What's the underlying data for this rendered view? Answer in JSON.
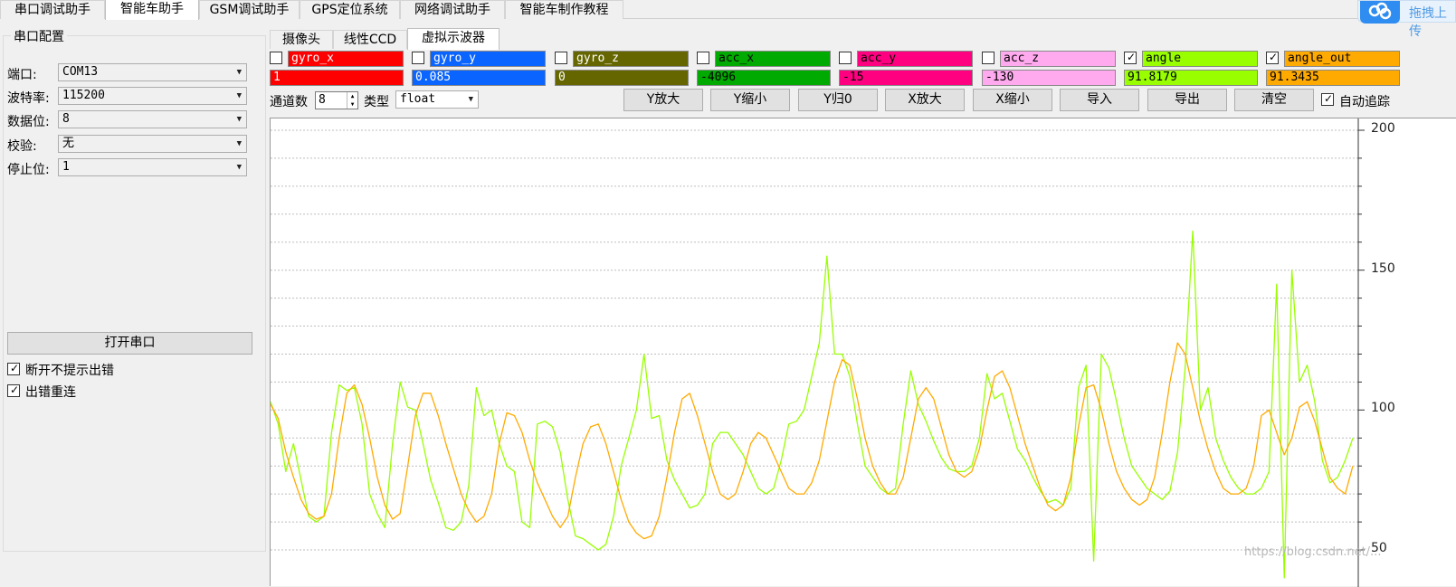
{
  "top_tabs": [
    {
      "label": "串口调试助手"
    },
    {
      "label": "智能车助手"
    },
    {
      "label": "GSM调试助手"
    },
    {
      "label": "GPS定位系统"
    },
    {
      "label": "网络调试助手"
    },
    {
      "label": "智能车制作教程"
    }
  ],
  "upload": {
    "label": "拖拽上传"
  },
  "serial_config": {
    "title": "串口配置",
    "fields": [
      {
        "label": "端口:",
        "value": "COM13"
      },
      {
        "label": "波特率:",
        "value": "115200"
      },
      {
        "label": "数据位:",
        "value": "8"
      },
      {
        "label": "校验:",
        "value": "无"
      },
      {
        "label": "停止位:",
        "value": "1"
      }
    ],
    "open_button": "打开串口",
    "options": [
      {
        "label": "断开不提示出错",
        "checked": true
      },
      {
        "label": "出错重连",
        "checked": true
      }
    ]
  },
  "inner_tabs": [
    {
      "label": "摄像头"
    },
    {
      "label": "线性CCD"
    },
    {
      "label": "虚拟示波器"
    }
  ],
  "channels": [
    {
      "name": "gyro_x",
      "value": "1",
      "checked": false,
      "color": "#ff0000",
      "text_color": "#ffffff"
    },
    {
      "name": "gyro_y",
      "value": "0.085",
      "checked": false,
      "color": "#0a64ff",
      "text_color": "#ffffff"
    },
    {
      "name": "gyro_z",
      "value": "0",
      "checked": false,
      "color": "#666600",
      "text_color": "#ffffff"
    },
    {
      "name": "acc_x",
      "value": "-4096",
      "checked": false,
      "color": "#00aa00",
      "text_color": "#000000"
    },
    {
      "name": "acc_y",
      "value": "-15",
      "checked": false,
      "color": "#ff0080",
      "text_color": "#000000"
    },
    {
      "name": "acc_z",
      "value": "-130",
      "checked": false,
      "color": "#ffaaee",
      "text_color": "#000000"
    },
    {
      "name": "angle",
      "value": "91.8179",
      "checked": true,
      "color": "#99ff00",
      "text_color": "#000000"
    },
    {
      "name": "angle_out",
      "value": "91.3435",
      "checked": true,
      "color": "#ffaa00",
      "text_color": "#000000"
    }
  ],
  "toolbar": {
    "channel_count_label": "通道数",
    "channel_count": "8",
    "type_label": "类型",
    "type_value": "float",
    "buttons": [
      "Y放大",
      "Y缩小",
      "Y归0",
      "X放大",
      "X缩小",
      "导入",
      "导出",
      "清空"
    ],
    "auto_track_label": "自动追踪",
    "auto_track_checked": true
  },
  "plot": {
    "y_ticks": [
      "200",
      "150",
      "100",
      "50"
    ],
    "series_colors": {
      "angle": "#99ff00",
      "angle_out": "#ffaa00"
    },
    "watermark": "https://blog.csdn.net/..."
  },
  "chart_data": {
    "type": "line",
    "ylim": [
      50,
      200
    ],
    "series": [
      {
        "name": "angle",
        "y": [
          103,
          95,
          78,
          88,
          75,
          62,
          60,
          62,
          92,
          109,
          107,
          108,
          95,
          70,
          63,
          58,
          88,
          110,
          101,
          100,
          88,
          75,
          67,
          58,
          57,
          60,
          73,
          108,
          98,
          100,
          88,
          80,
          78,
          60,
          58,
          95,
          96,
          94,
          85,
          68,
          55,
          54,
          52,
          50,
          52,
          62,
          80,
          90,
          100,
          120,
          97,
          98,
          82,
          75,
          70,
          65,
          66,
          70,
          88,
          92,
          92,
          88,
          84,
          78,
          72,
          70,
          72,
          82,
          95,
          96,
          100,
          112,
          124,
          155,
          120,
          120,
          112,
          95,
          80,
          76,
          72,
          70,
          72,
          95,
          114,
          102,
          96,
          89,
          83,
          79,
          78,
          78,
          80,
          90,
          113,
          104,
          106,
          96,
          86,
          82,
          76,
          71,
          67,
          68,
          66,
          72,
          108,
          116,
          46,
          120,
          115,
          103,
          90,
          80,
          76,
          72,
          70,
          68,
          71,
          85,
          115,
          164,
          100,
          108,
          90,
          82,
          76,
          72,
          70,
          70,
          72,
          78,
          145,
          40,
          150,
          110,
          116,
          103,
          82,
          74,
          76,
          82,
          90
        ]
      },
      {
        "name": "angle_out",
        "y": [
          102,
          97,
          85,
          76,
          68,
          63,
          61,
          62,
          70,
          90,
          106,
          109,
          102,
          90,
          76,
          66,
          61,
          63,
          80,
          98,
          106,
          106,
          98,
          88,
          79,
          70,
          64,
          60,
          62,
          70,
          88,
          99,
          98,
          92,
          82,
          74,
          68,
          62,
          58,
          62,
          76,
          88,
          94,
          95,
          88,
          78,
          68,
          60,
          56,
          54,
          55,
          62,
          76,
          92,
          104,
          106,
          98,
          88,
          78,
          70,
          68,
          70,
          78,
          88,
          92,
          90,
          84,
          78,
          72,
          70,
          70,
          74,
          82,
          96,
          110,
          118,
          116,
          104,
          90,
          80,
          74,
          70,
          70,
          76,
          90,
          104,
          108,
          104,
          94,
          84,
          78,
          76,
          78,
          86,
          100,
          112,
          114,
          108,
          98,
          88,
          80,
          72,
          66,
          64,
          66,
          76,
          94,
          108,
          109,
          100,
          88,
          78,
          72,
          68,
          66,
          68,
          76,
          92,
          110,
          124,
          120,
          108,
          96,
          86,
          78,
          72,
          70,
          70,
          72,
          80,
          98,
          100,
          92,
          84,
          90,
          101,
          103,
          96,
          86,
          76,
          72,
          70,
          80
        ]
      }
    ]
  }
}
